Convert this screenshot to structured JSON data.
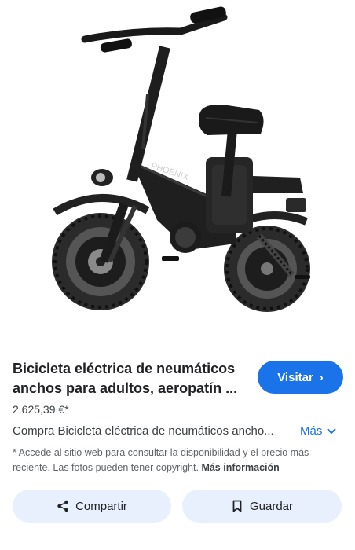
{
  "product": {
    "title": "Bicicleta eléctrica de neumáticos anchos para adultos, aeropatín ...",
    "price": "2.625,39 €*",
    "description": "Compra Bicicleta eléctrica de neumáticos ancho...",
    "more_label": "Más",
    "image_brand_text": "PHOENIX"
  },
  "actions": {
    "visit_label": "Visitar",
    "share_label": "Compartir",
    "save_label": "Guardar"
  },
  "disclaimer": {
    "text": "* Accede al sitio web para consultar la disponibilidad y el precio más reciente. Las fotos pueden tener copyright. ",
    "more_info": "Más información"
  },
  "colors": {
    "accent": "#1a73e8",
    "button_bg": "#e8f0fe"
  }
}
